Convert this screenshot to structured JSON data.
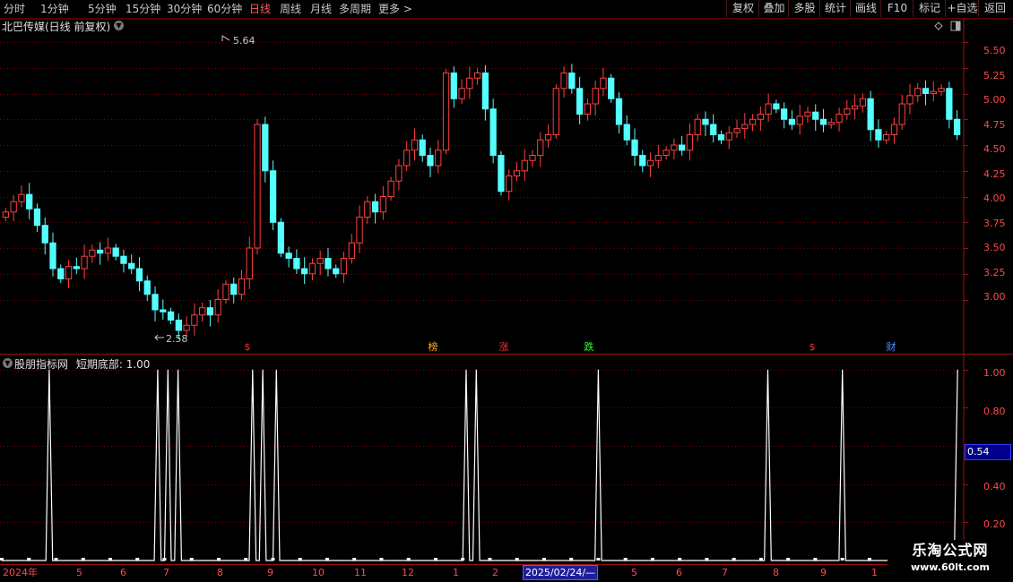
{
  "toolbar": {
    "periods": [
      "分时",
      "1分钟",
      "5分钟",
      "15分钟",
      "30分钟",
      "60分钟",
      "日线",
      "周线",
      "月线",
      "多周期",
      "更多 >"
    ],
    "active_period": "日线",
    "right_buttons": [
      "复权",
      "叠加",
      "多股",
      "统计",
      "画线",
      "F10",
      "标记",
      "+自选",
      "返回"
    ]
  },
  "main_chart": {
    "title": "北巴传媒(日线 前复权)",
    "price_labels": [
      "5.50",
      "5.25",
      "5.00",
      "4.75",
      "4.50",
      "4.25",
      "4.00",
      "3.75",
      "3.50",
      "3.25",
      "3.00"
    ],
    "high_annotation": "5.64",
    "low_annotation": "2.58",
    "event_markers": [
      {
        "label": "$",
        "color": "#ff3030"
      },
      {
        "label": "榜",
        "color": "#ffb020"
      },
      {
        "label": "涨",
        "color": "#ff3030"
      },
      {
        "label": "跌",
        "color": "#30ff30"
      },
      {
        "label": "$",
        "color": "#ff3030"
      },
      {
        "label": "财",
        "color": "#5090ff"
      }
    ],
    "icons": [
      "diamond-icon",
      "toggle-panel-icon"
    ]
  },
  "indicator": {
    "title": "股朋指标网",
    "name": "短期底部",
    "value": "1.00",
    "y_labels": [
      "1.00",
      "0.80",
      "0.40",
      "0.20"
    ],
    "current_badge": "0.54"
  },
  "date_axis": {
    "labels": [
      "2024年",
      "5",
      "6",
      "7",
      "8",
      "9",
      "10",
      "11",
      "12",
      "1",
      "2",
      "5",
      "6",
      "7",
      "8",
      "9",
      "1"
    ],
    "cursor_date": "2025/02/24/—"
  },
  "watermark": {
    "line1": "乐淘公式网",
    "line2": "www.60lt.com"
  },
  "colors": {
    "up": "#ff4040",
    "down": "#54ffff",
    "grid": "#7a0000",
    "axis": "#a01010",
    "indicator_line": "#ffffff"
  },
  "chart_data": [
    {
      "type": "candlestick",
      "title": "北巴传媒(日线 前复权)",
      "ylim": [
        2.5,
        5.7
      ],
      "y_ticks": [
        3.0,
        3.25,
        3.5,
        3.75,
        4.0,
        4.25,
        4.5,
        4.75,
        5.0,
        5.25,
        5.5
      ],
      "series": [
        {
          "values": [
            3.85,
            3.95,
            4.02,
            3.88,
            3.72,
            3.55,
            3.3,
            3.2,
            3.32,
            3.3,
            3.42,
            3.48,
            3.45,
            3.5,
            3.42,
            3.35,
            3.3,
            3.18,
            3.05,
            2.9,
            2.88,
            2.8,
            2.7,
            2.75,
            2.85,
            2.92,
            2.85,
            3.0,
            3.15,
            3.05,
            3.2,
            3.5,
            4.7,
            4.25,
            3.75,
            3.45,
            3.4,
            3.3,
            3.25,
            3.35,
            3.4,
            3.3,
            3.25,
            3.4,
            3.55,
            3.8,
            3.95,
            3.85,
            4.0,
            4.15,
            4.3,
            4.45,
            4.55,
            4.4,
            4.3,
            4.45,
            5.2,
            4.95,
            5.05,
            5.15,
            5.2,
            4.85,
            4.4,
            4.05,
            4.2,
            4.25,
            4.35,
            4.4,
            4.55,
            4.6,
            5.05,
            5.2,
            5.05,
            4.8,
            4.9,
            5.05,
            5.15,
            4.95,
            4.7,
            4.55,
            4.4,
            4.3,
            4.35,
            4.4,
            4.45,
            4.5,
            4.45,
            4.6,
            4.75,
            4.7,
            4.6,
            4.55,
            4.62,
            4.66,
            4.7,
            4.75,
            4.8,
            4.9,
            4.85,
            4.75,
            4.7,
            4.78,
            4.82,
            4.75,
            4.7,
            4.72,
            4.8,
            4.85,
            4.88,
            4.95,
            4.65,
            4.55,
            4.6,
            4.7,
            4.9,
            4.98,
            5.05,
            5.0,
            5.02,
            5.05,
            4.75,
            4.6
          ]
        }
      ]
    },
    {
      "type": "line",
      "title": "短期底部",
      "ylim": [
        0,
        1.05
      ],
      "y_ticks": [
        0.2,
        0.4,
        0.8,
        1.0
      ],
      "series": [
        {
          "values": [
            0,
            0,
            0,
            0,
            0,
            0,
            0,
            0,
            0,
            0,
            0,
            0,
            0,
            0,
            1,
            0,
            0,
            0,
            0,
            0,
            0,
            0,
            0,
            0,
            0,
            0,
            0,
            0,
            0,
            0,
            0,
            0,
            0,
            0,
            0,
            0,
            0,
            0,
            0,
            0,
            0,
            0,
            0,
            0,
            0,
            0,
            1,
            0,
            0,
            1,
            0,
            0,
            1,
            0,
            0,
            0,
            0,
            0,
            0,
            0,
            0,
            0,
            0,
            0,
            0,
            0,
            0,
            0,
            0,
            0,
            0,
            0,
            0,
            0,
            1,
            0,
            0,
            1,
            0,
            0,
            0,
            1,
            0,
            0,
            0,
            0,
            0,
            0,
            0,
            0,
            0,
            0,
            0,
            0,
            0,
            0,
            0,
            0,
            0,
            0,
            0,
            0,
            0,
            0,
            0,
            0,
            0,
            0,
            0,
            0,
            0,
            0,
            0,
            0,
            0,
            0,
            0,
            0,
            0,
            0,
            0,
            0,
            0,
            0,
            0,
            0,
            0,
            0,
            0,
            0,
            0,
            0,
            0,
            0,
            0,
            0,
            0,
            1,
            0,
            0,
            1,
            0,
            0,
            0,
            0,
            0,
            0,
            0,
            0,
            0,
            0,
            0,
            0,
            0,
            0,
            0,
            0,
            0,
            0,
            0,
            0,
            0,
            0,
            0,
            0,
            0,
            0,
            0,
            0,
            0,
            0,
            0,
            0,
            0,
            0,
            0,
            1,
            0,
            0,
            0,
            0,
            0,
            0,
            0,
            0,
            0,
            0,
            0,
            0,
            0,
            0,
            0,
            0,
            0,
            0,
            0,
            0,
            0,
            0,
            0,
            0,
            0,
            0,
            0,
            0,
            0,
            0,
            0,
            0,
            0,
            0,
            0,
            0,
            0,
            0,
            0,
            0,
            0,
            0,
            0,
            0,
            0,
            0,
            0,
            0,
            0,
            1,
            0,
            0,
            0,
            0,
            0,
            0,
            0,
            0,
            0,
            0,
            0,
            0,
            0,
            0,
            0,
            0,
            0,
            0,
            0,
            0,
            0,
            1,
            0,
            0,
            0,
            0,
            0,
            0,
            0,
            0,
            0,
            0,
            0,
            0,
            0,
            0,
            0,
            0,
            0,
            0,
            0,
            0,
            0,
            0,
            0,
            0,
            0,
            0,
            0,
            0,
            0,
            0,
            0,
            0,
            0,
            1
          ]
        }
      ]
    }
  ]
}
